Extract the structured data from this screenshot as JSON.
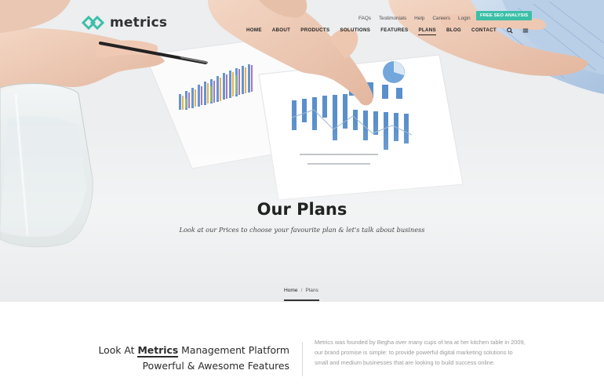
{
  "brand": {
    "name": "metrics",
    "logo_icon": "metrics-logo-icon"
  },
  "topbar": {
    "links": [
      "FAQs",
      "Testimonials",
      "Help",
      "Careers",
      "Login"
    ],
    "cta": "FREE SEO ANALYSIS"
  },
  "nav": {
    "items": [
      "HOME",
      "ABOUT",
      "PRODUCTS",
      "SOLUTIONS",
      "FEATURES",
      "PLANS",
      "BLOG",
      "CONTACT"
    ],
    "active": "PLANS",
    "icons": [
      "search-icon",
      "menu-icon"
    ]
  },
  "hero": {
    "title": "Our Plans",
    "subtitle": "Look at our Prices to choose your favourite plan & let's talk about business"
  },
  "breadcrumb": {
    "home": "Home",
    "separator": "/",
    "current": "Plans"
  },
  "intro": {
    "line1_prefix": "Look At",
    "line1_brand": "Metrics",
    "line1_suffix": "Management Platform",
    "line2": "Powerful & Awesome Features",
    "description": "Metrics was founded by Begha over many cups of tea at her kitchen table in 2009, our brand promise is simple: to provide powerful digital marketing solutions to small and medium businesses that are looking to build success online."
  },
  "colors": {
    "accent": "#3bbfa8",
    "text_dark": "#222222",
    "muted": "#9a9a9a"
  }
}
